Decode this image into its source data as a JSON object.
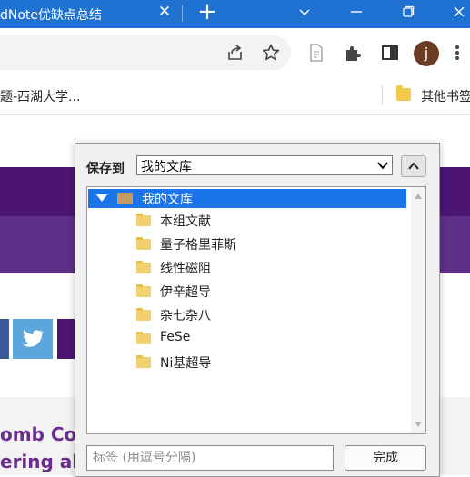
{
  "browser": {
    "tab_title": "dNote优缺点总结",
    "bookmarks_left": "题-西湖大学...",
    "bookmarks_right": "其他书签",
    "profile_initial": "j",
    "accent": "#1f72d2"
  },
  "page": {
    "article_line1": "omb Corr",
    "article_line2": "ering abo"
  },
  "dialog": {
    "save_to_label": "保存到",
    "save_to_value": "我的文库",
    "tree": {
      "root": "我的文库",
      "items": [
        "本组文献",
        "量子格里菲斯",
        "线性磁阻",
        "伊辛超导",
        "杂七杂八",
        "FeSe",
        "Ni基超导"
      ]
    },
    "tags_placeholder": "标签 (用逗号分隔)",
    "done_label": "完成"
  }
}
